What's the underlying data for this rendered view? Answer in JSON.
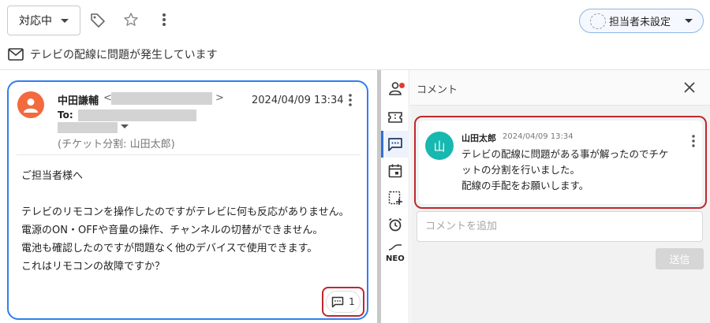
{
  "toolbar": {
    "status_label": "対応中",
    "tag_icon": "tag-icon",
    "star_icon": "star-icon",
    "more_icon": "more-vert-icon",
    "assignee_label": "担当者未設定"
  },
  "ticket": {
    "subject": "テレビの配線に問題が発生しています"
  },
  "email": {
    "sender_name": "中田謙輔",
    "lt": "<",
    "gt": ">",
    "date": "2024/04/09 13:34",
    "to_label": "To:",
    "split_note": "(チケット分割: 山田太郎)",
    "body": [
      "ご担当者様へ",
      "",
      "テレビのリモコンを操作したのですがテレビに何も反応がありません。",
      "電源のON・OFFや音量の操作、チャンネルの切替ができません。",
      "電池も確認したのですが問題なく他のデバイスで使用できます。",
      "これはリモコンの故障ですか？"
    ],
    "comment_count": "1"
  },
  "sidenav": {
    "neo_label": "NEO"
  },
  "comments_panel": {
    "title": "コメント",
    "comment": {
      "avatar_initial": "山",
      "author": "山田太郎",
      "time": "2024/04/09 13:34",
      "text": [
        "テレビの配線に問題がある事が解ったのでチケ",
        "ットの分割を行いました。",
        "配線の手配をお願いします。"
      ]
    },
    "input_placeholder": "コメントを追加",
    "send_label": "送信"
  },
  "colors": {
    "accent_blue": "#2f80ed",
    "highlight_red": "#c0272d",
    "avatar_orange": "#f26a3d",
    "avatar_teal": "#17b8b0",
    "notification_red": "#e53935"
  }
}
